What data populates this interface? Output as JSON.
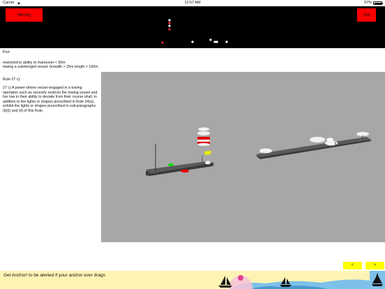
{
  "status_bar": {
    "carrier": "Carrier",
    "time": "12:57 AM",
    "battery": "97%"
  },
  "header": {
    "wrong_label": "Wrong",
    "counter": "3/6"
  },
  "answer": {
    "vessel_label": "Port",
    "description_line1": "restricted in ability to maneuver < 50m",
    "description_line2": "towing a submerged vessel: breadth > 25m length > 100m"
  },
  "rule": {
    "title": "Rule 27 c):",
    "text": "27 c) A power-driven vessel engaged in a towing operation such as severely restricts the towing vessel and her tow in their ability to deviate from their course shall, in addition to the lights or shapes prescribed in Rule 24(a), exhibit the lights or shapes prescribed in sub-paragraphs (b)(i) and (ii) of this Rule."
  },
  "navigation": {
    "prev_label": "<",
    "next_label": ">"
  },
  "ad": {
    "text": "Get Anchor! to be alerted if your anchor ever drags"
  },
  "colors": {
    "header_bg": "#000000",
    "button_red": "#ff0000",
    "nav_yellow": "#ffff00",
    "scene_bg": "#a7a7a7",
    "ad_bg": "#fdf4b4"
  }
}
